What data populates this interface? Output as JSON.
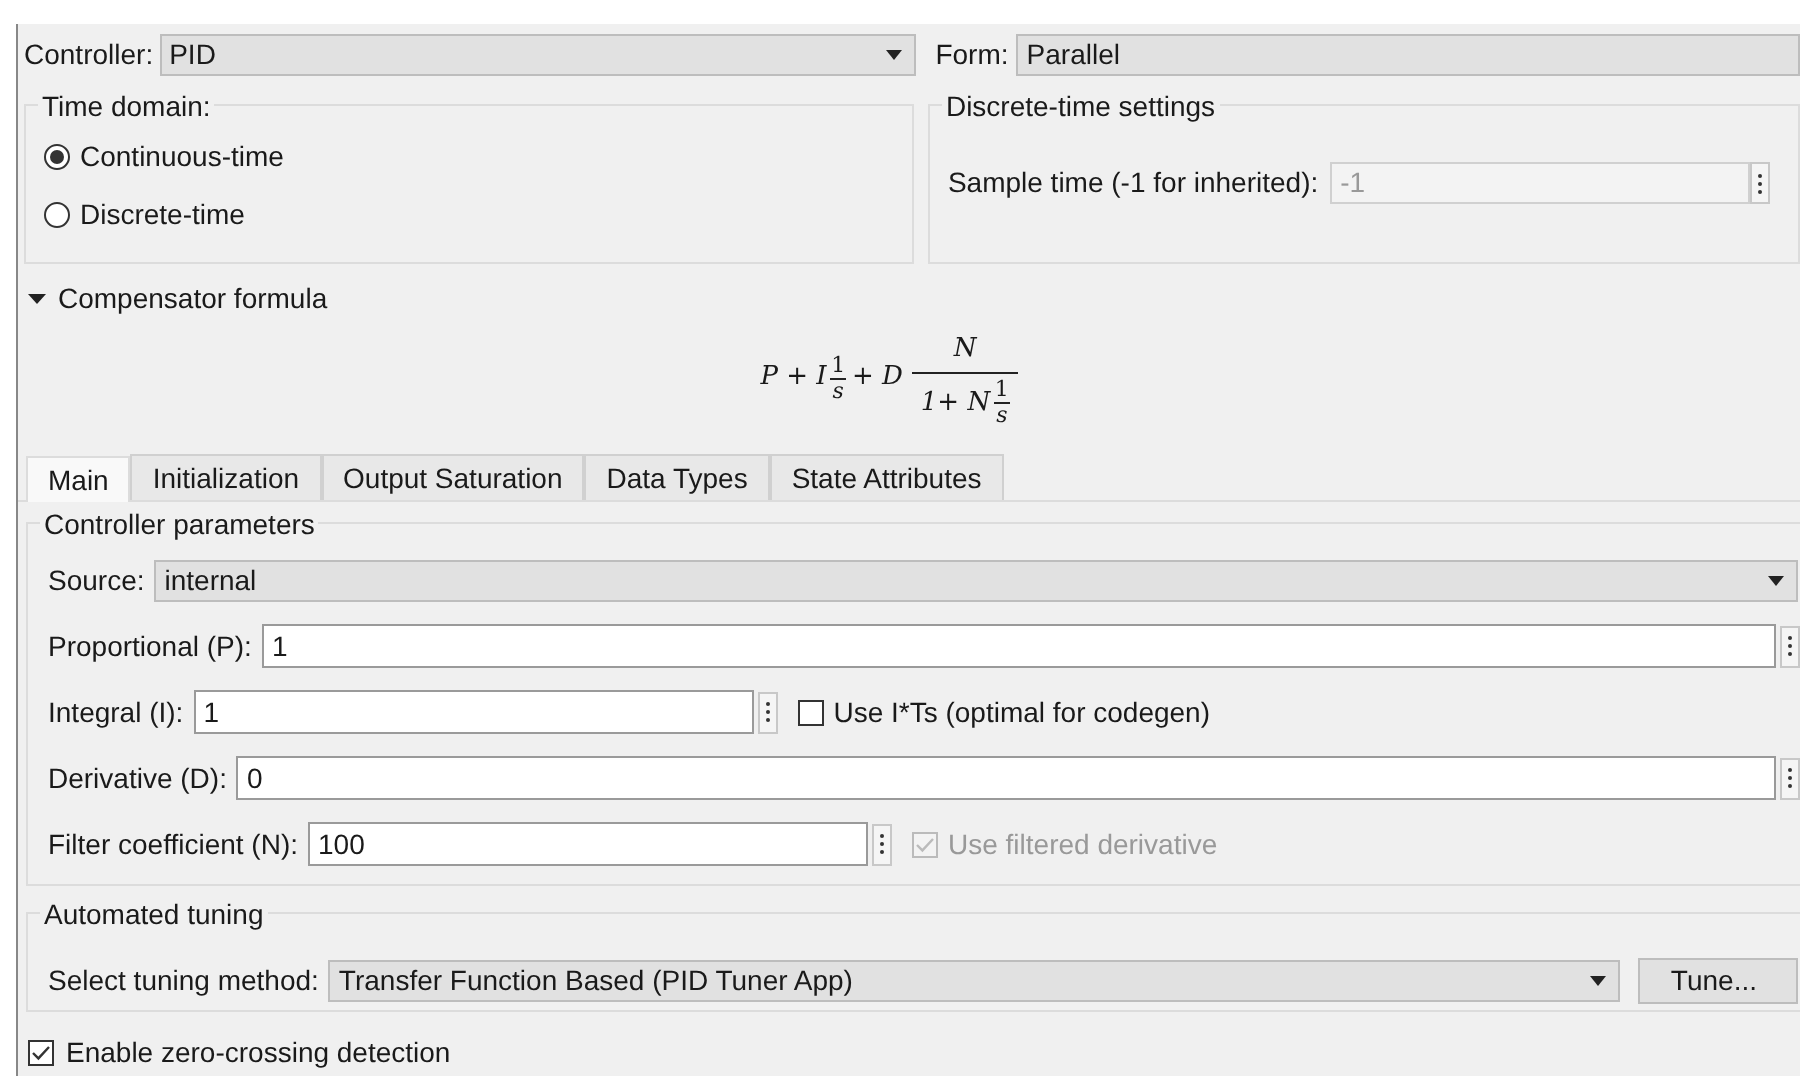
{
  "controller": {
    "label": "Controller:",
    "value": "PID"
  },
  "form": {
    "label": "Form:",
    "value": "Parallel"
  },
  "time_domain": {
    "title": "Time domain:",
    "options": [
      {
        "label": "Continuous-time",
        "selected": true
      },
      {
        "label": "Discrete-time",
        "selected": false
      }
    ]
  },
  "discrete_settings": {
    "title": "Discrete-time settings",
    "sample_time": {
      "label": "Sample time (-1 for inherited):",
      "value": "-1",
      "disabled": true
    }
  },
  "compensator": {
    "label": "Compensator formula",
    "expanded": true,
    "formula": {
      "lead": "P + I",
      "frac1": {
        "num": "1",
        "den": "s"
      },
      "mid": "+ D",
      "frac2": {
        "num": "N",
        "den_lead": "1+ N",
        "den_frac": {
          "num": "1",
          "den": "s"
        }
      }
    }
  },
  "tabs": [
    {
      "label": "Main",
      "selected": true
    },
    {
      "label": "Initialization",
      "selected": false
    },
    {
      "label": "Output Saturation",
      "selected": false
    },
    {
      "label": "Data Types",
      "selected": false
    },
    {
      "label": "State Attributes",
      "selected": false
    }
  ],
  "controller_parameters": {
    "title": "Controller parameters",
    "source": {
      "label": "Source:",
      "value": "internal"
    },
    "rows": [
      {
        "label": "Proportional (P):",
        "value": "1"
      },
      {
        "label": "Integral (I):",
        "value": "1",
        "option": {
          "label": "Use I*Ts (optimal for codegen)",
          "checked": false,
          "disabled": false
        }
      },
      {
        "label": "Derivative (D):",
        "value": "0"
      },
      {
        "label": "Filter coefficient (N):",
        "value": "100",
        "option": {
          "label": "Use filtered derivative",
          "checked": true,
          "disabled": true
        }
      }
    ]
  },
  "automated_tuning": {
    "title": "Automated tuning",
    "method_label": "Select tuning method:",
    "method": "Transfer Function Based (PID Tuner App)",
    "button": "Tune..."
  },
  "zero_crossing": {
    "label": "Enable zero-crossing detection",
    "checked": true
  }
}
